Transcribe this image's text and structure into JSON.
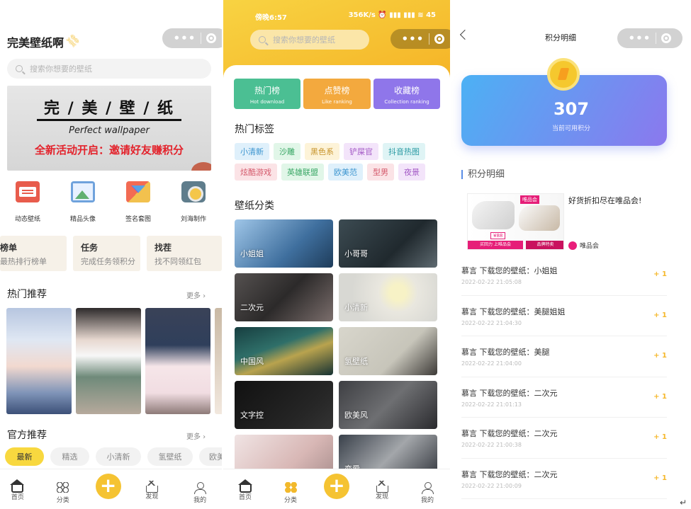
{
  "p1": {
    "title": "完美壁纸啊",
    "search_placeholder": "搜索你想要的壁纸",
    "banner": {
      "title": "完 / 美 / 壁 / 纸",
      "subtitle": "Perfect wallpaper",
      "promo": "全新活动开启：邀请好友赚积分"
    },
    "icons": [
      {
        "label": "动态壁纸",
        "icon": "radio-icon"
      },
      {
        "label": "精品头像",
        "icon": "photo-icon"
      },
      {
        "label": "签名套图",
        "icon": "signature-icon"
      },
      {
        "label": "刘海制作",
        "icon": "camera-icon"
      }
    ],
    "cards": [
      {
        "title": "榜单",
        "sub": "最热排行榜单"
      },
      {
        "title": "任务",
        "sub": "完成任务领积分"
      },
      {
        "title": "找茬",
        "sub": "找不同领红包"
      }
    ],
    "hot_title": "热门推荐",
    "hot_more": "更多 ›",
    "official_title": "官方推荐",
    "official_more": "更多 ›",
    "tabs": [
      "最新",
      "精选",
      "小清新",
      "氢壁纸",
      "欧美"
    ],
    "nav": [
      "首页",
      "分类",
      "发现",
      "我的"
    ]
  },
  "p2": {
    "status_time": "傍晚6:57",
    "status_right": "356K/s ⏰ ▮▮▮ ▮▮▮ ≋ 45",
    "search_placeholder": "搜索你想要的壁纸",
    "ranks": [
      {
        "title": "热门榜",
        "sub": "Hot download",
        "color": "#4bbf93"
      },
      {
        "title": "点赞榜",
        "sub": "Like ranking",
        "color": "#f3a93e"
      },
      {
        "title": "收藏榜",
        "sub": "Collection ranking",
        "color": "#8f76ea"
      }
    ],
    "tags_title": "热门标签",
    "tags": [
      {
        "label": "小清新",
        "bg": "#dff0fb",
        "fg": "#3b94cf"
      },
      {
        "label": "沙雕",
        "bg": "#e1f6e8",
        "fg": "#3aa766"
      },
      {
        "label": "黑色系",
        "bg": "#fdf3d8",
        "fg": "#c7932a"
      },
      {
        "label": "铲屎官",
        "bg": "#f3e4fa",
        "fg": "#a45bc6"
      },
      {
        "label": "抖音热图",
        "bg": "#dff4f5",
        "fg": "#2a9aa3"
      },
      {
        "label": "炫酷游戏",
        "bg": "#fbe3e6",
        "fg": "#d4596b"
      },
      {
        "label": "英雄联盟",
        "bg": "#e1f6e8",
        "fg": "#3aa766"
      },
      {
        "label": "欧美范",
        "bg": "#dff0fb",
        "fg": "#3b94cf"
      },
      {
        "label": "型男",
        "bg": "#fbe3e6",
        "fg": "#d4596b"
      },
      {
        "label": "夜景",
        "bg": "#f3e4fa",
        "fg": "#a45bc6"
      }
    ],
    "cat_title": "壁纸分类",
    "categories": [
      "小姐姐",
      "小哥哥",
      "二次元",
      "小清新",
      "中国风",
      "氢壁纸",
      "文字控",
      "欧美风",
      "",
      "恋爱"
    ],
    "nav": [
      "首页",
      "分类",
      "发现",
      "我的"
    ]
  },
  "p3": {
    "title": "积分明细",
    "points": "307",
    "points_label": "当前可用积分",
    "section": "积分明细",
    "ad": {
      "title": "好货折扣尽在唯品会!",
      "brand": "唯品会",
      "img_tag": "唯品会",
      "img_badge": "品牌特卖",
      "img_btn": "买回力 上唯品会",
      "img_price": "¥88"
    },
    "records": [
      {
        "text": "慕言 下载您的壁纸：小姐姐",
        "date": "2022-02-22 21:05:08",
        "pts": "+ 1"
      },
      {
        "text": "慕言 下载您的壁纸：美腿姐姐",
        "date": "2022-02-22 21:04:30",
        "pts": "+ 1"
      },
      {
        "text": "慕言 下载您的壁纸：美腿",
        "date": "2022-02-22 21:04:00",
        "pts": "+ 1"
      },
      {
        "text": "慕言 下载您的壁纸：二次元",
        "date": "2022-02-22 21:01:13",
        "pts": "+ 1"
      },
      {
        "text": "慕言 下载您的壁纸：二次元",
        "date": "2022-02-22 21:00:38",
        "pts": "+ 1"
      },
      {
        "text": "慕言 下载您的壁纸：二次元",
        "date": "2022-02-22 21:00:09",
        "pts": "+ 1"
      }
    ]
  }
}
